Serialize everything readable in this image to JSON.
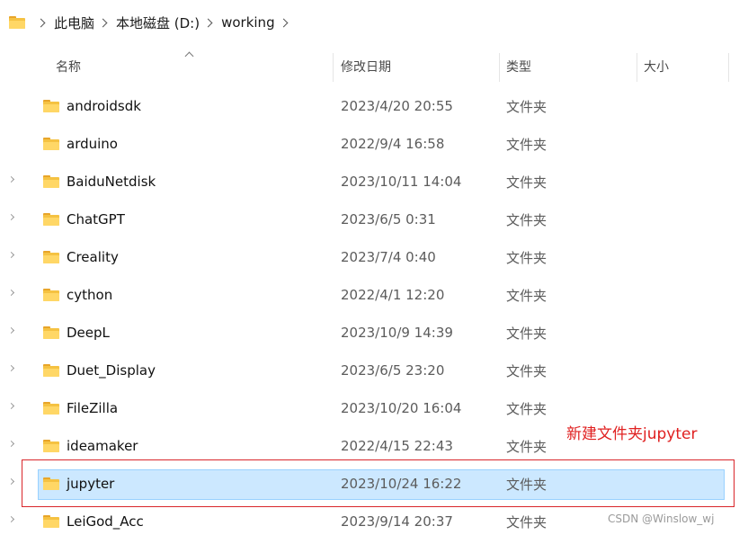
{
  "breadcrumb": {
    "items": [
      "此电脑",
      "本地磁盘 (D:)",
      "working"
    ]
  },
  "columns": {
    "name": "名称",
    "date": "修改日期",
    "type": "类型",
    "size": "大小"
  },
  "rows": [
    {
      "name": "androidsdk",
      "date": "2023/4/20 20:55",
      "type": "文件夹",
      "expandable": false
    },
    {
      "name": "arduino",
      "date": "2022/9/4 16:58",
      "type": "文件夹",
      "expandable": false
    },
    {
      "name": "BaiduNetdisk",
      "date": "2023/10/11 14:04",
      "type": "文件夹",
      "expandable": true
    },
    {
      "name": "ChatGPT",
      "date": "2023/6/5 0:31",
      "type": "文件夹",
      "expandable": true
    },
    {
      "name": "Creality",
      "date": "2023/7/4 0:40",
      "type": "文件夹",
      "expandable": true
    },
    {
      "name": "cython",
      "date": "2022/4/1 12:20",
      "type": "文件夹",
      "expandable": true
    },
    {
      "name": "DeepL",
      "date": "2023/10/9 14:39",
      "type": "文件夹",
      "expandable": true
    },
    {
      "name": "Duet_Display",
      "date": "2023/6/5 23:20",
      "type": "文件夹",
      "expandable": true
    },
    {
      "name": "FileZilla",
      "date": "2023/10/20 16:04",
      "type": "文件夹",
      "expandable": true
    },
    {
      "name": "ideamaker",
      "date": "2022/4/15 22:43",
      "type": "文件夹",
      "expandable": true
    },
    {
      "name": "jupyter",
      "date": "2023/10/24 16:22",
      "type": "文件夹",
      "expandable": true,
      "selected": true
    },
    {
      "name": "LeiGod_Acc",
      "date": "2023/9/14 20:37",
      "type": "文件夹",
      "expandable": true
    }
  ],
  "annotation": {
    "label": "新建文件夹jupyter",
    "color": "#e02020"
  },
  "watermark": "CSDN @Winslow_wj",
  "colors": {
    "selection_bg": "#cce8ff",
    "selection_border": "#99d1ff",
    "folder": "#f5c242"
  }
}
